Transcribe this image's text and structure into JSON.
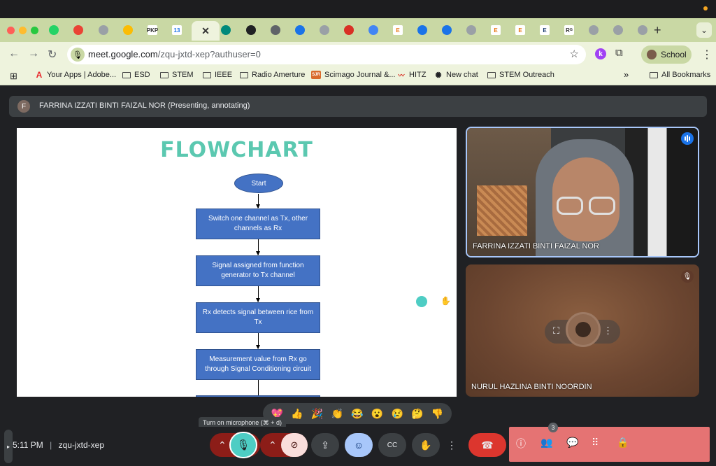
{
  "browser": {
    "tabs": [
      {
        "icon": "whatsapp-icon",
        "color": "#25d366"
      },
      {
        "icon": "gmail-icon",
        "color": "#ea4335"
      },
      {
        "icon": "globe-icon",
        "color": "#9aa0a6"
      },
      {
        "icon": "drive-icon",
        "color": "#fbbc04"
      },
      {
        "icon": "pkp-icon",
        "color": "#333333"
      },
      {
        "icon": "calendar-icon",
        "color": "#1a73e8"
      },
      {
        "icon": "meet-icon",
        "color": "#00897b"
      },
      {
        "icon": "chatgpt-icon",
        "color": "#202124"
      },
      {
        "icon": "doc-icon",
        "color": "#5f6368"
      },
      {
        "icon": "gear-icon",
        "color": "#1a73e8"
      },
      {
        "icon": "image-icon",
        "color": "#9aa0a6"
      },
      {
        "icon": "hitz-icon",
        "color": "#d93025"
      },
      {
        "icon": "layers-icon",
        "color": "#4285f4"
      },
      {
        "icon": "e-icon",
        "color": "#e8710a"
      },
      {
        "icon": "shield-icon",
        "color": "#1a73e8"
      },
      {
        "icon": "shield-icon",
        "color": "#1a73e8"
      },
      {
        "icon": "globe-icon",
        "color": "#9aa0a6"
      },
      {
        "icon": "e-icon",
        "color": "#e8710a"
      },
      {
        "icon": "e-icon",
        "color": "#e8710a"
      },
      {
        "icon": "elsevier-icon",
        "color": "#1a3a6e"
      },
      {
        "icon": "researchgate-icon",
        "color": "#333333"
      },
      {
        "icon": "globe-icon",
        "color": "#9aa0a6"
      },
      {
        "icon": "globe-icon",
        "color": "#9aa0a6"
      },
      {
        "icon": "globe-icon",
        "color": "#9aa0a6"
      },
      {
        "icon": "globe-icon",
        "color": "#9aa0a6"
      }
    ],
    "tab_labels": {
      "pkp": "PKP",
      "cal": "13",
      "e": "E",
      "elsevier": "E",
      "rg": "Rᴳ"
    },
    "url_host": "meet.google.com",
    "url_path": "/zqu-jxtd-xep?authuser=0",
    "profile_letter": "k",
    "profile_name": "School",
    "bookmarks": [
      {
        "label": "Your Apps | Adobe...",
        "icon": "adobe-icon"
      },
      {
        "label": "ESD",
        "icon": "folder-icon"
      },
      {
        "label": "STEM",
        "icon": "folder-icon"
      },
      {
        "label": "IEEE",
        "icon": "folder-icon"
      },
      {
        "label": "Radio Amerture",
        "icon": "folder-icon"
      },
      {
        "label": "Scimago Journal &...",
        "icon": "scimago-icon"
      },
      {
        "label": "HITZ",
        "icon": "hitz-icon"
      },
      {
        "label": "New chat",
        "icon": "chatgpt-icon"
      },
      {
        "label": "STEM Outreach",
        "icon": "folder-icon"
      }
    ],
    "more_bookmarks": "»",
    "all_bookmarks": "All Bookmarks"
  },
  "meet": {
    "presenter_initial": "F",
    "presenter_label": "FARRINA IZZATI BINTI FAIZAL NOR (Presenting, annotating)",
    "slide": {
      "title": "FLOWCHART",
      "start": "Start",
      "steps": [
        "Switch one channel as Tx, other channels as Rx",
        "Signal assigned from function generator to Tx channel",
        "Rx detects signal between rice from Tx",
        "Measurement value from Rx go through Signal Conditioning circuit"
      ]
    },
    "participants": [
      {
        "name": "FARRINA IZZATI BINTI FAIZAL NOR",
        "speaking": true
      },
      {
        "name": "NURUL HAZLINA BINTI NOORDIN",
        "muted": true
      }
    ],
    "reactions": [
      "💖",
      "👍",
      "🎉",
      "👏",
      "😂",
      "😮",
      "😢",
      "🤔",
      "👎"
    ],
    "tooltip": "Turn on microphone (⌘ + d)",
    "time": "5:11 PM",
    "meeting_code": "zqu-jxtd-xep",
    "people_count": "3"
  }
}
